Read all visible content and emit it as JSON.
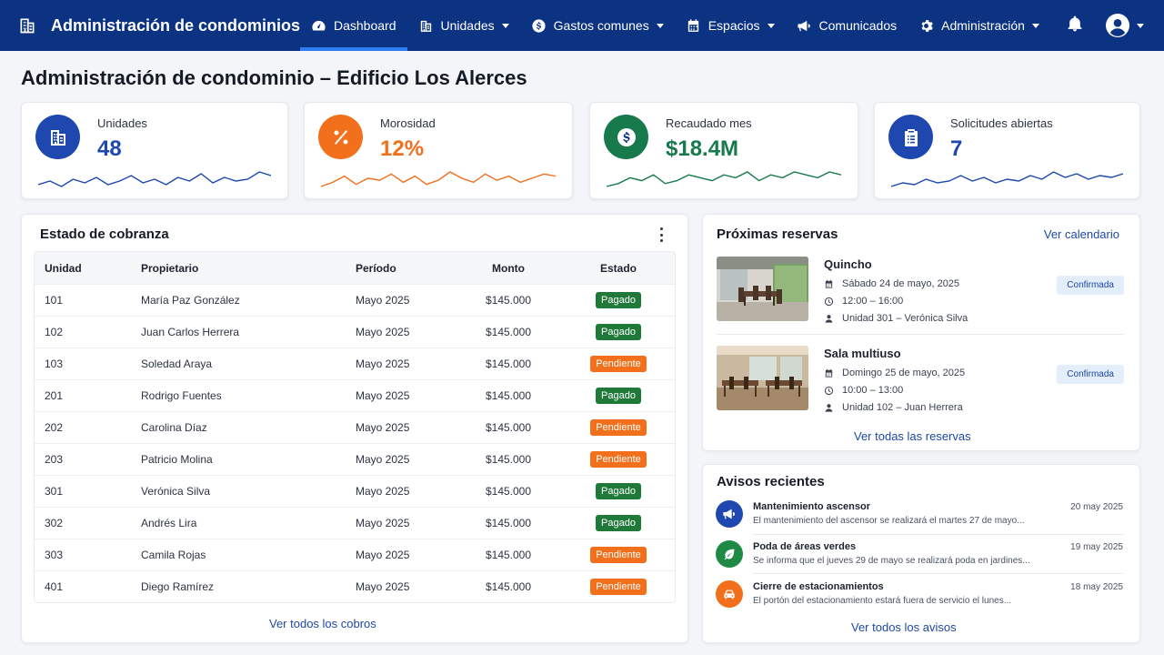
{
  "nav": {
    "brand": "Administración de condominios",
    "items": [
      {
        "label": "Dashboard",
        "icon": "gauge-icon",
        "active": true,
        "dropdown": false
      },
      {
        "label": "Unidades",
        "icon": "building-icon",
        "active": false,
        "dropdown": true
      },
      {
        "label": "Gastos comunes",
        "icon": "dollar-icon",
        "active": false,
        "dropdown": true
      },
      {
        "label": "Espacios",
        "icon": "calendar-icon",
        "active": false,
        "dropdown": true
      },
      {
        "label": "Comunicados",
        "icon": "megaphone-icon",
        "active": false,
        "dropdown": false
      },
      {
        "label": "Administración",
        "icon": "gear-icon",
        "active": false,
        "dropdown": true
      }
    ]
  },
  "page": {
    "title": "Administración de condominio – Edificio Los Alerces"
  },
  "kpis": [
    {
      "label": "Unidades",
      "value": "48",
      "icon": "building-icon",
      "color": "#1e48b0",
      "valueColor": "#1e48b0",
      "spark": [
        5,
        7,
        4,
        8,
        6,
        9,
        5,
        7,
        10,
        6,
        8,
        5,
        9,
        7,
        11,
        6,
        9,
        7,
        8,
        12,
        10
      ]
    },
    {
      "label": "Morosidad",
      "value": "12%",
      "icon": "percent-icon",
      "color": "#f26f1b",
      "valueColor": "#f26f1b",
      "spark": [
        4,
        6,
        9,
        5,
        8,
        7,
        10,
        6,
        9,
        5,
        7,
        11,
        8,
        6,
        10,
        7,
        9,
        6,
        8,
        10,
        9
      ]
    },
    {
      "label": "Recaudado mes",
      "value": "$18.4M",
      "icon": "dollar-icon",
      "color": "#167a4c",
      "valueColor": "#167a4c",
      "spark": [
        4,
        5,
        7,
        6,
        8,
        5,
        6,
        8,
        7,
        6,
        8,
        7,
        9,
        6,
        8,
        7,
        9,
        8,
        7,
        9,
        8
      ]
    },
    {
      "label": "Solicitudes abiertas",
      "value": "7",
      "icon": "clipboard-icon",
      "color": "#1e48b0",
      "valueColor": "#1e48b0",
      "spark": [
        3,
        5,
        4,
        7,
        5,
        6,
        9,
        6,
        8,
        5,
        7,
        6,
        9,
        7,
        11,
        8,
        10,
        7,
        9,
        8,
        10
      ]
    }
  ],
  "cobranza": {
    "title": "Estado de cobranza",
    "columns": [
      "Unidad",
      "Propietario",
      "Período",
      "Monto",
      "Estado"
    ],
    "rows": [
      {
        "unit": "101",
        "owner": "María Paz González",
        "period": "Mayo 2025",
        "amount": "$145.000",
        "status": "Pagado"
      },
      {
        "unit": "102",
        "owner": "Juan Carlos Herrera",
        "period": "Mayo 2025",
        "amount": "$145.000",
        "status": "Pagado"
      },
      {
        "unit": "103",
        "owner": "Soledad Araya",
        "period": "Mayo 2025",
        "amount": "$145.000",
        "status": "Pendiente"
      },
      {
        "unit": "201",
        "owner": "Rodrigo Fuentes",
        "period": "Mayo 2025",
        "amount": "$145.000",
        "status": "Pagado"
      },
      {
        "unit": "202",
        "owner": "Carolina Díaz",
        "period": "Mayo 2025",
        "amount": "$145.000",
        "status": "Pendiente"
      },
      {
        "unit": "203",
        "owner": "Patricio Molina",
        "period": "Mayo 2025",
        "amount": "$145.000",
        "status": "Pendiente"
      },
      {
        "unit": "301",
        "owner": "Verónica Silva",
        "period": "Mayo 2025",
        "amount": "$145.000",
        "status": "Pagado"
      },
      {
        "unit": "302",
        "owner": "Andrés Lira",
        "period": "Mayo 2025",
        "amount": "$145.000",
        "status": "Pagado"
      },
      {
        "unit": "303",
        "owner": "Camila Rojas",
        "period": "Mayo 2025",
        "amount": "$145.000",
        "status": "Pendiente"
      },
      {
        "unit": "401",
        "owner": "Diego Ramírez",
        "period": "Mayo 2025",
        "amount": "$145.000",
        "status": "Pendiente"
      }
    ],
    "footer_link": "Ver todos los cobros"
  },
  "reservas": {
    "title": "Próximas reservas",
    "header_link": "Ver calendario",
    "items": [
      {
        "name": "Quincho",
        "date": "Sábado 24 de mayo, 2025",
        "time": "12:00 – 16:00",
        "unit": "Unidad 301 – Verónica Silva",
        "status": "Confirmada"
      },
      {
        "name": "Sala multiuso",
        "date": "Domingo 25 de mayo, 2025",
        "time": "10:00 – 13:00",
        "unit": "Unidad 102 – Juan Herrera",
        "status": "Confirmada"
      }
    ],
    "footer_link": "Ver todas las reservas"
  },
  "avisos": {
    "title": "Avisos recientes",
    "items": [
      {
        "title": "Mantenimiento ascensor",
        "text": "El mantenimiento del ascensor se realizará el martes 27 de mayo...",
        "date": "20 may 2025",
        "icon": "megaphone-icon",
        "color": "#1e48b0"
      },
      {
        "title": "Poda de áreas verdes",
        "text": "Se informa que el jueves 29 de mayo se realizará poda en jardines...",
        "date": "19 may 2025",
        "icon": "leaf-icon",
        "color": "#1f8a46"
      },
      {
        "title": "Cierre de estacionamientos",
        "text": "El portón del estacionamiento estará fuera de servicio el lunes...",
        "date": "18 may 2025",
        "icon": "car-icon",
        "color": "#f26f1b"
      }
    ],
    "footer_link": "Ver todos los avisos"
  }
}
